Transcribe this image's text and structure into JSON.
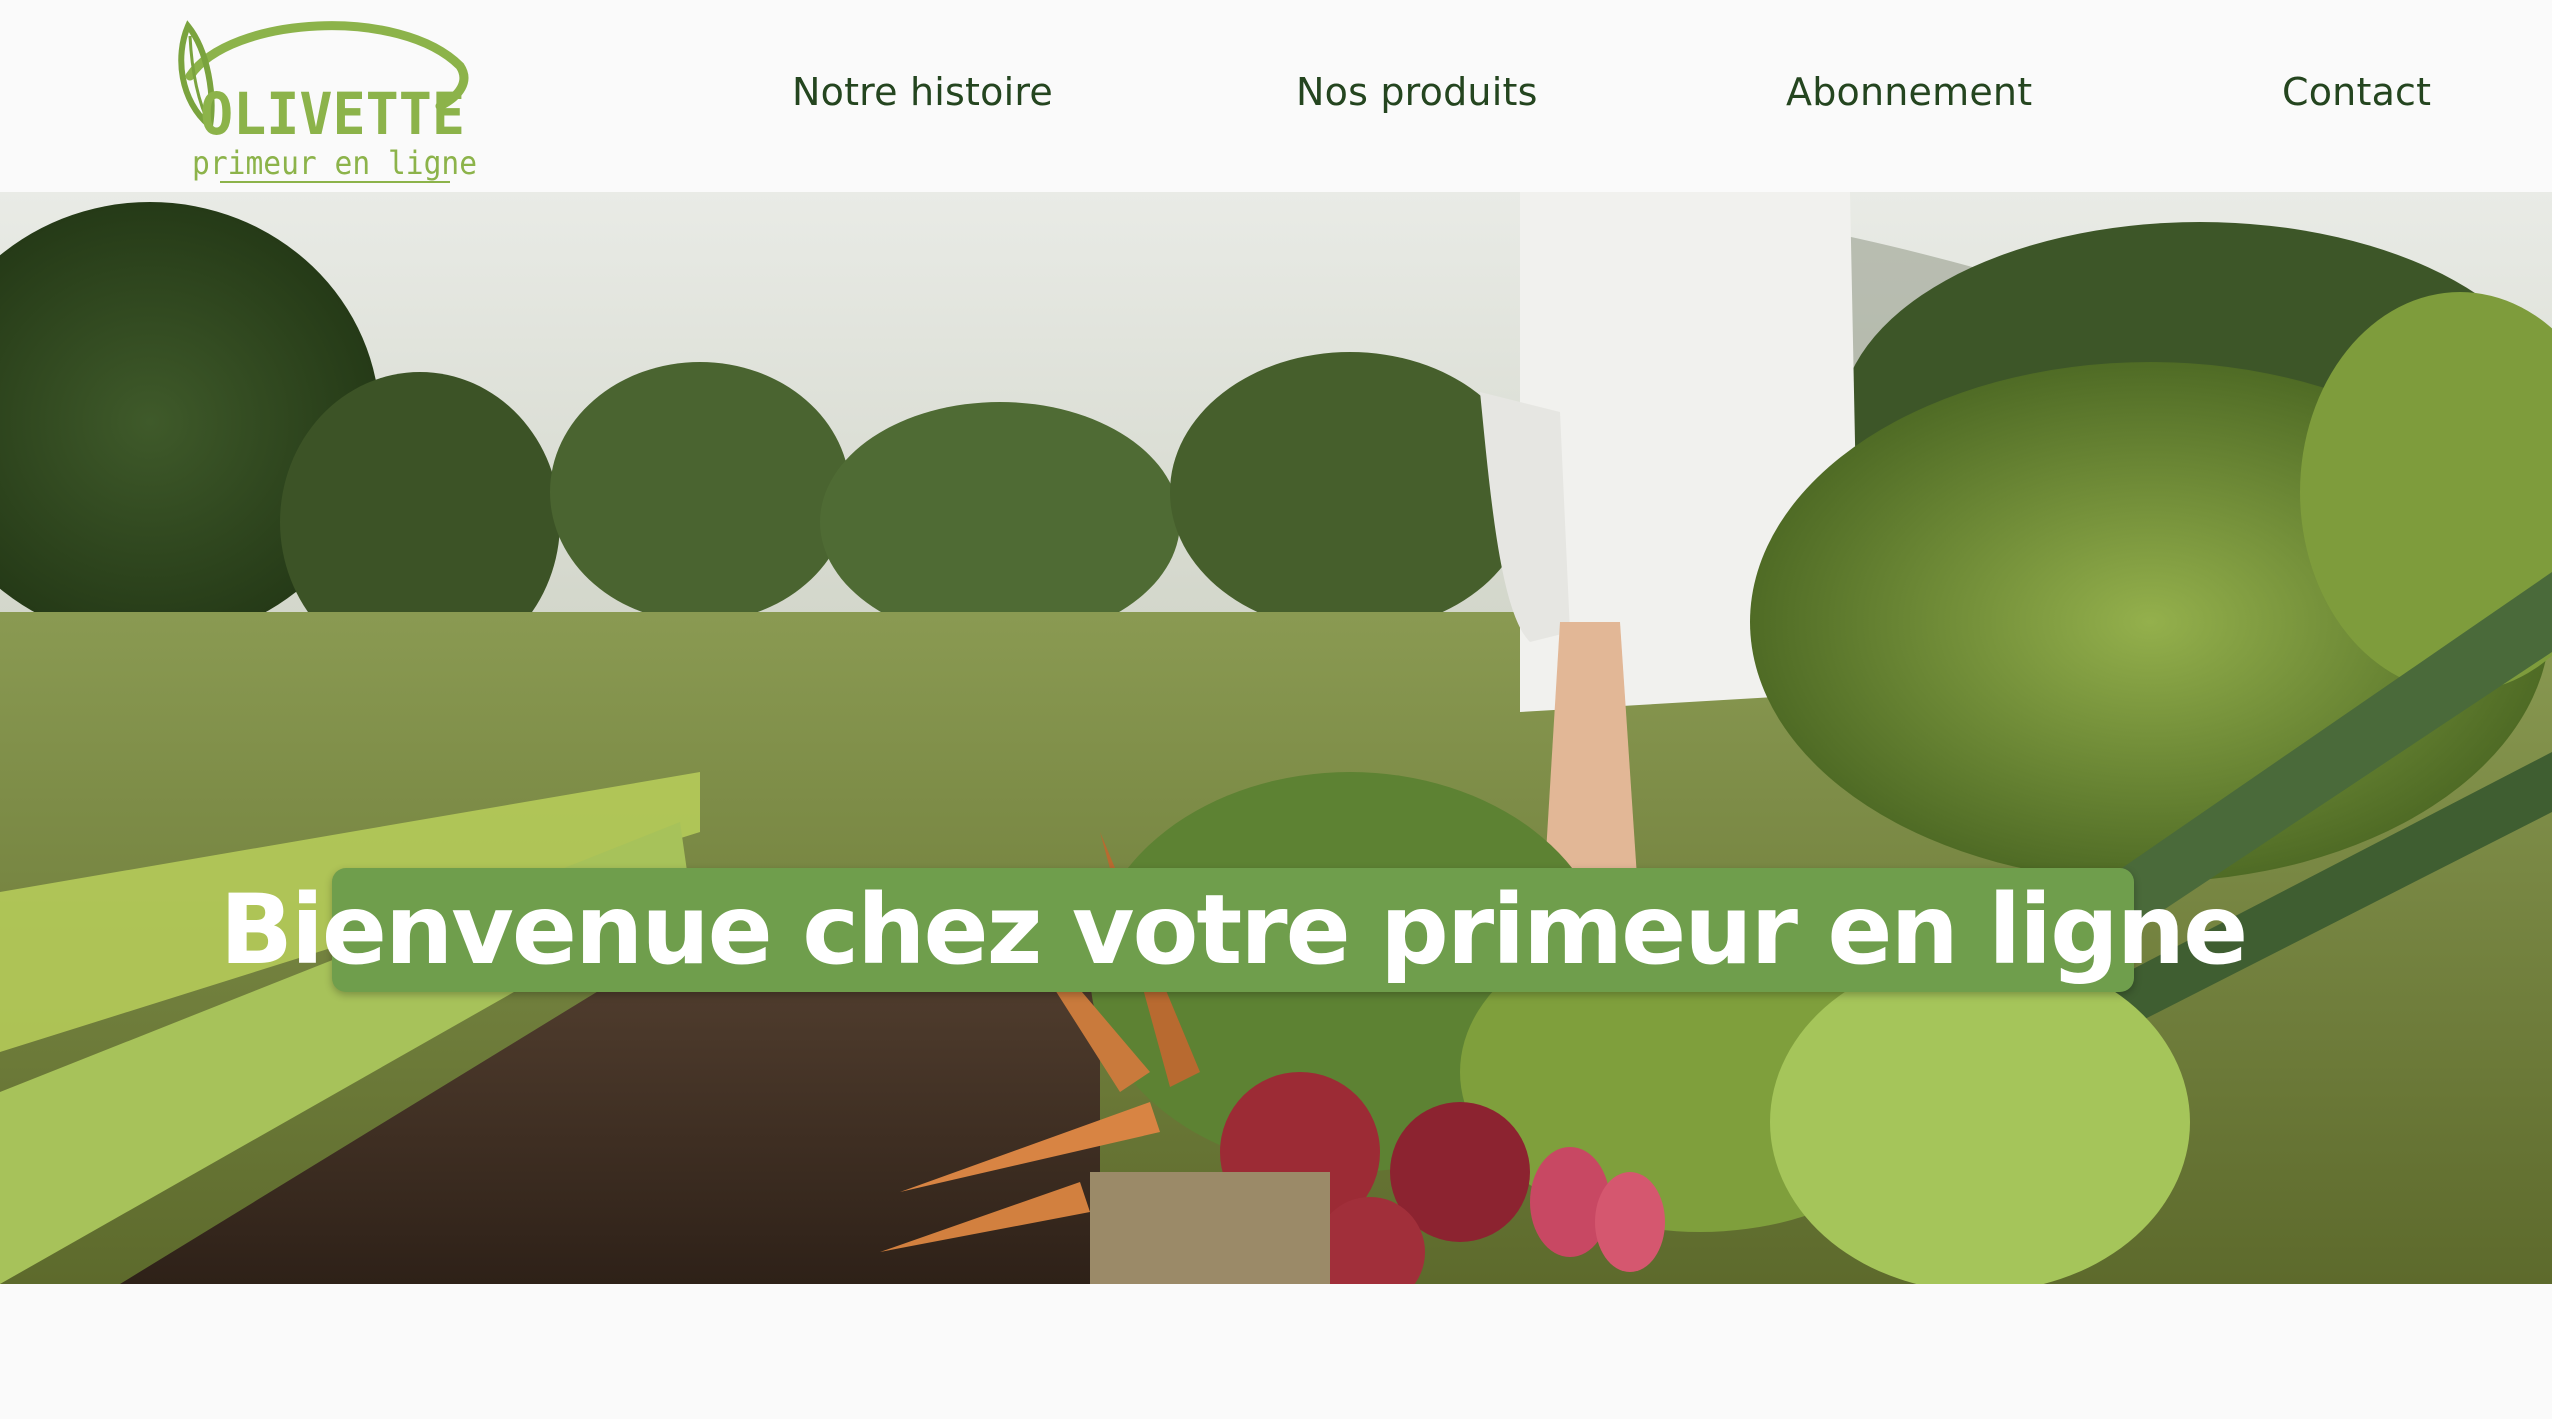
{
  "brand": {
    "name": "OLIVETTE",
    "tagline": "primeur en ligne",
    "logo_color": "#8cb34a"
  },
  "nav": {
    "items": [
      {
        "label": "Notre histoire"
      },
      {
        "label": "Nos produits"
      },
      {
        "label": "Abonnement"
      },
      {
        "label": "Contact"
      }
    ],
    "text_color": "#24451f"
  },
  "hero": {
    "title": "Bienvenue chez votre primeur en ligne",
    "banner_color": "#6f9e4c",
    "image_description_icon": "vegetable-garden-photo"
  }
}
